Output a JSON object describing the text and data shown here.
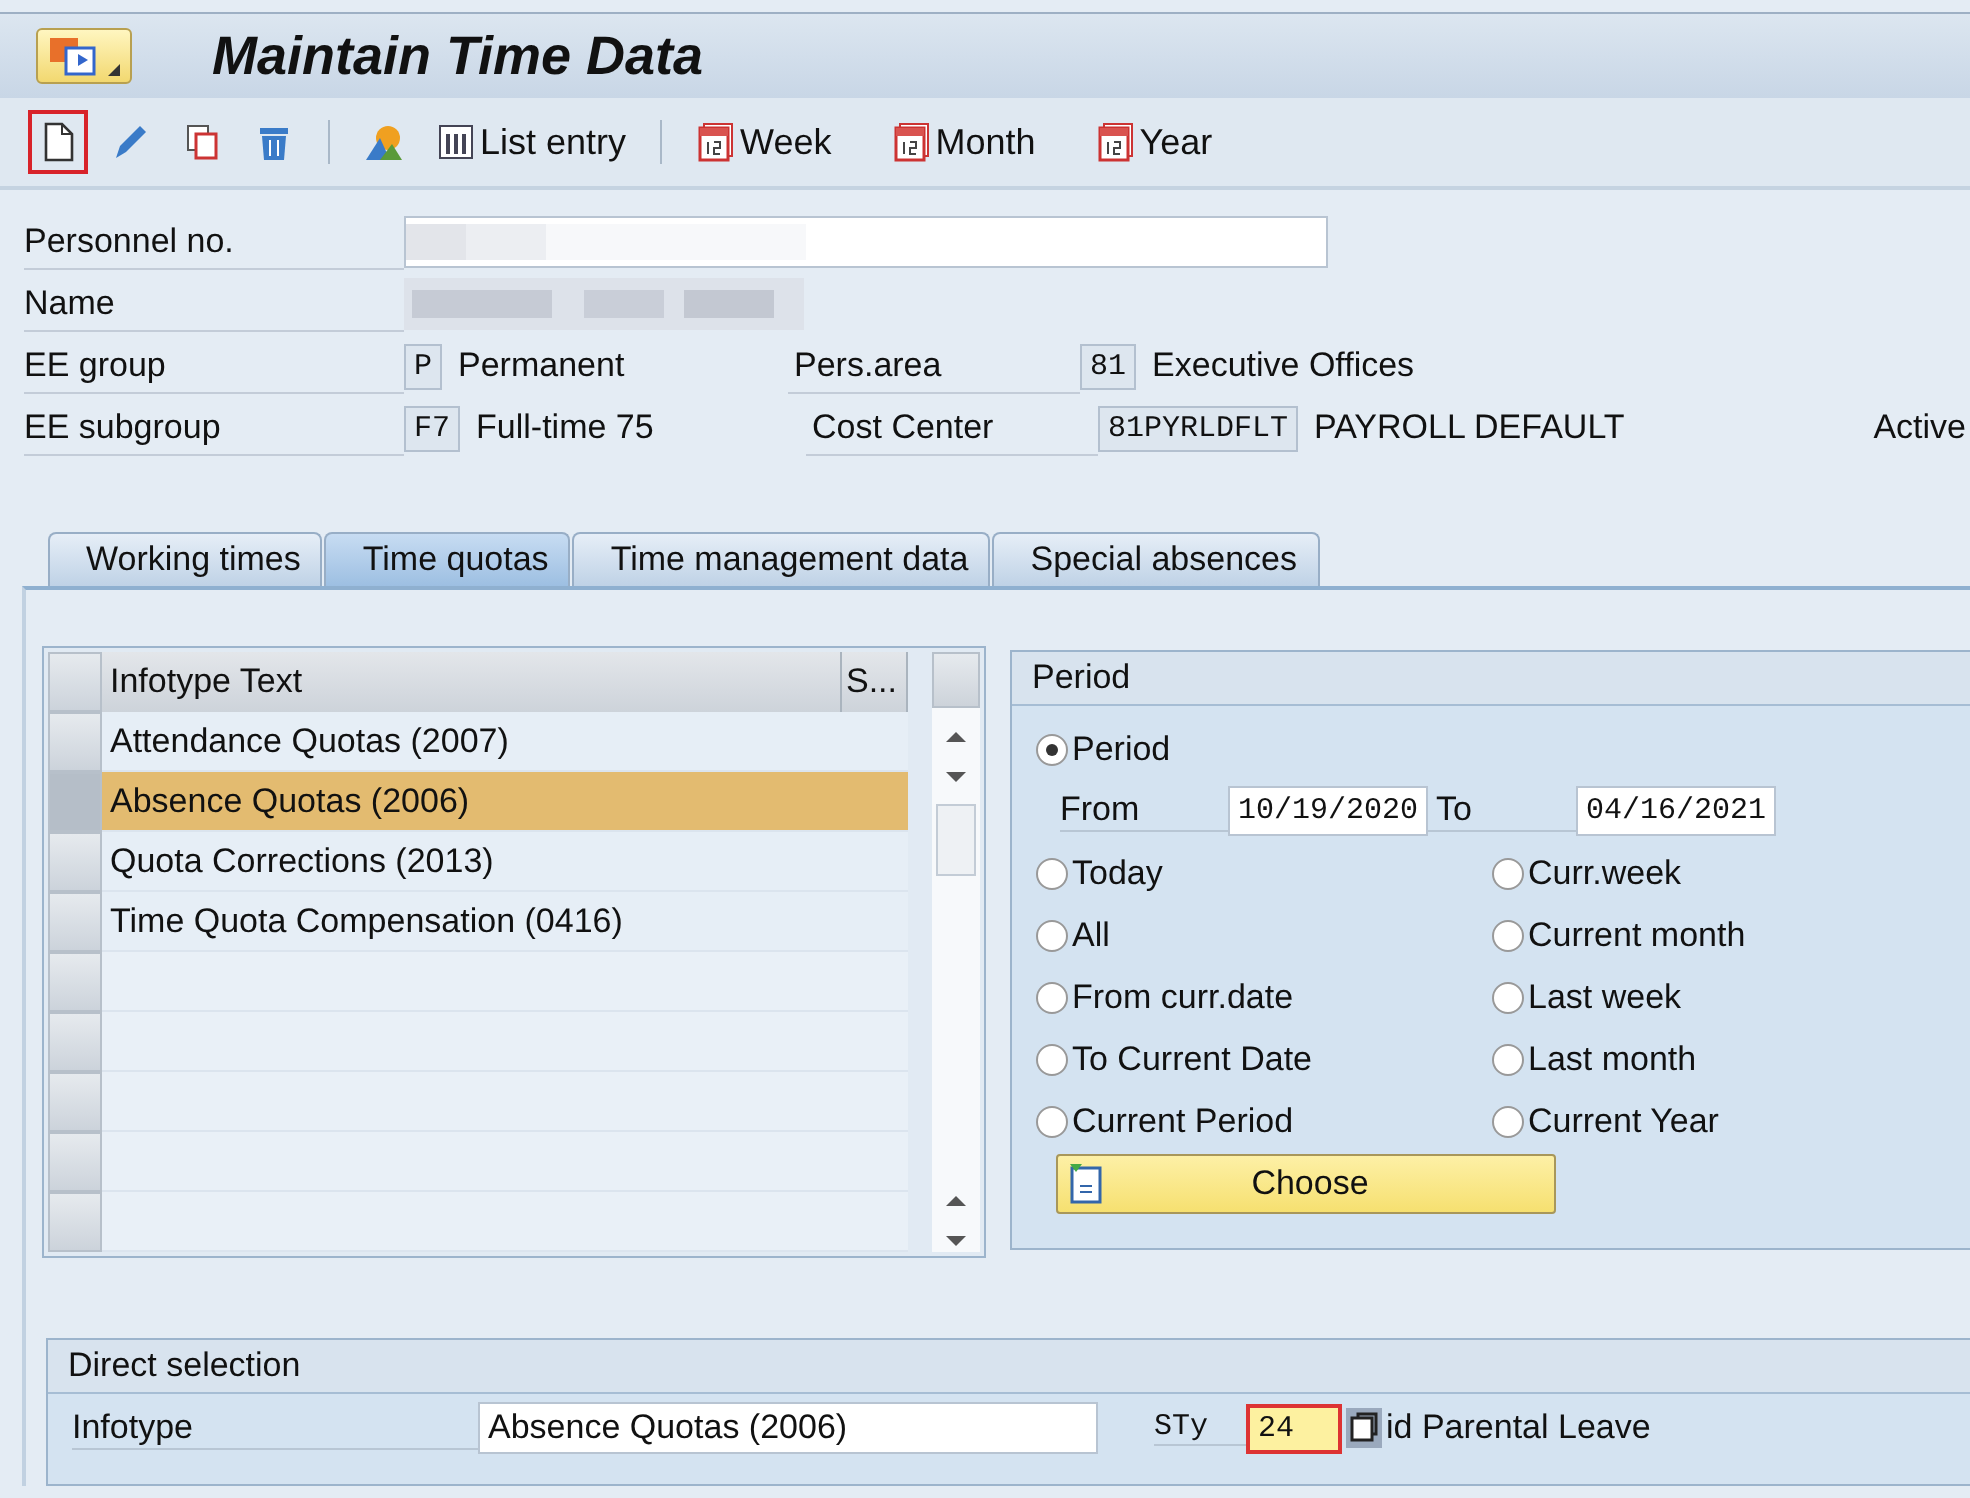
{
  "title": "Maintain Time Data",
  "toolbar": [
    {
      "outlined": true
    },
    {
      "outlined": false
    },
    {
      "outlined": false
    },
    {
      "outlined": false
    },
    {
      "outlined": false
    },
    {
      "label": "List entry",
      "outlined": false
    },
    {
      "label": "Week",
      "outlined": false
    },
    {
      "label": "Month",
      "outlined": false
    },
    {
      "label": "Year",
      "outlined": false
    }
  ],
  "header": {
    "personnel_label": "Personnel no.",
    "name_label": "Name",
    "ee_group": {
      "label": "EE group",
      "code": "P",
      "text": "Permanent"
    },
    "ee_subgroup": {
      "label": "EE subgroup",
      "code": "F7",
      "text": "Full-time 75"
    },
    "pers_area": {
      "label": "Pers.area",
      "code": "81",
      "text": "Executive Offices"
    },
    "cost_center": {
      "label": "Cost Center",
      "code": "81PYRLDFLT",
      "text": "PAYROLL DEFAULT"
    },
    "status": "Active"
  },
  "tabs": [
    {
      "label": "Working times",
      "selected": false
    },
    {
      "label": "Time quotas",
      "selected": true
    },
    {
      "label": "Time management data",
      "selected": false
    },
    {
      "label": "Special absences",
      "selected": false
    }
  ],
  "table": {
    "columns": [
      "Infotype Text",
      "S..."
    ],
    "rows": [
      {
        "text": "Attendance Quotas (2007)",
        "selected": false
      },
      {
        "text": "Absence Quotas (2006)",
        "selected": true
      },
      {
        "text": "Quota Corrections (2013)",
        "selected": false
      },
      {
        "text": "Time Quota Compensation (0416)",
        "selected": false
      }
    ]
  },
  "period": {
    "title": "Period",
    "main_option": {
      "label": "Period",
      "selected": true
    },
    "from_label": "From",
    "from_value": "10/19/2020",
    "to_label": "To",
    "to_value": "04/16/2021",
    "left_options": [
      {
        "label": "Today",
        "selected": false
      },
      {
        "label": "All",
        "selected": false
      },
      {
        "label": "From curr.date",
        "selected": false
      },
      {
        "label": "To Current Date",
        "selected": false
      },
      {
        "label": "Current Period",
        "selected": false
      }
    ],
    "right_options": [
      {
        "label": "Curr.week",
        "selected": false
      },
      {
        "label": "Current month",
        "selected": false
      },
      {
        "label": "Last week",
        "selected": false
      },
      {
        "label": "Last month",
        "selected": false
      },
      {
        "label": "Current Year",
        "selected": false
      }
    ],
    "button": "Choose"
  },
  "direct_selection": {
    "title": "Direct selection",
    "infotype_label": "Infotype",
    "infotype_value": "Absence Quotas (2006)",
    "sty_label": "STy",
    "sty_value": "24",
    "sty_text": "id Parental Leave"
  }
}
